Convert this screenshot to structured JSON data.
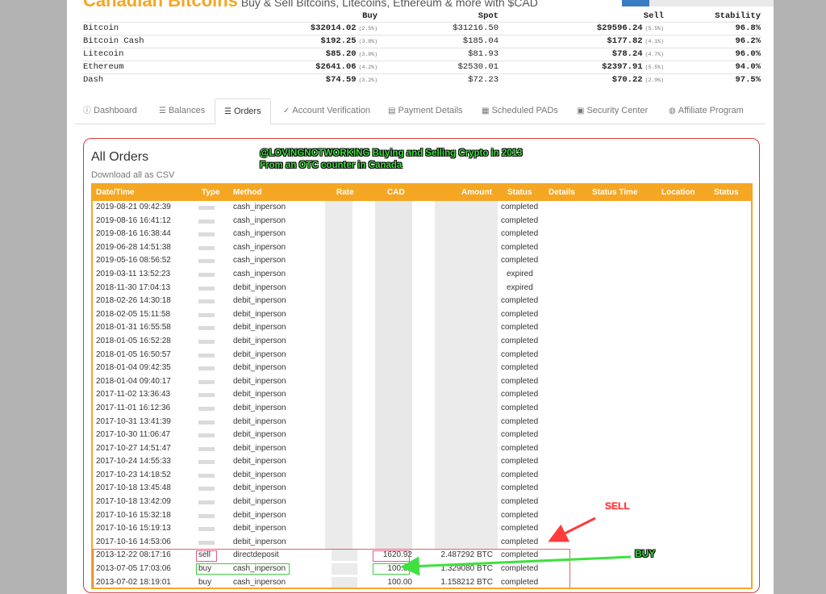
{
  "header": {
    "brand": "Canadian Bitcoins",
    "tagline": "Buy & Sell Bitcoins, Litecoins, Ethereum & more with $CAD"
  },
  "prices": {
    "columns": [
      "Buy",
      "Spot",
      "Sell",
      "Stability"
    ],
    "rows": [
      {
        "name": "Bitcoin",
        "buy": "$32014.02",
        "buy_pct": "(2.5%)",
        "spot": "$31216.50",
        "sell": "$29596.24",
        "sell_pct": "(5.5%)",
        "stability": "96.8%"
      },
      {
        "name": "Bitcoin Cash",
        "buy": "$192.25",
        "buy_pct": "(3.8%)",
        "spot": "$185.04",
        "sell": "$177.82",
        "sell_pct": "(4.1%)",
        "stability": "96.2%"
      },
      {
        "name": "Litecoin",
        "buy": "$85.20",
        "buy_pct": "(3.8%)",
        "spot": "$81.93",
        "sell": "$78.24",
        "sell_pct": "(4.7%)",
        "stability": "96.0%"
      },
      {
        "name": "Ethereum",
        "buy": "$2641.06",
        "buy_pct": "(4.2%)",
        "spot": "$2530.01",
        "sell": "$2397.91",
        "sell_pct": "(5.5%)",
        "stability": "94.0%"
      },
      {
        "name": "Dash",
        "buy": "$74.59",
        "buy_pct": "(3.2%)",
        "spot": "$72.23",
        "sell": "$70.22",
        "sell_pct": "(2.9%)",
        "stability": "97.5%"
      }
    ]
  },
  "tabs": [
    {
      "label": "Dashboard",
      "icon": "info-circle-icon",
      "glyph": "ⓘ"
    },
    {
      "label": "Balances",
      "icon": "list-icon",
      "glyph": "☰"
    },
    {
      "label": "Orders",
      "icon": "list-icon",
      "glyph": "☰",
      "active": true
    },
    {
      "label": "Account Verification",
      "icon": "check-circle-icon",
      "glyph": "✓"
    },
    {
      "label": "Payment Details",
      "icon": "truck-icon",
      "glyph": "▤"
    },
    {
      "label": "Scheduled PADs",
      "icon": "calendar-icon",
      "glyph": "▦"
    },
    {
      "label": "Security Center",
      "icon": "lock-icon",
      "glyph": "▣"
    },
    {
      "label": "Affiliate Program",
      "icon": "globe-icon",
      "glyph": "◍"
    }
  ],
  "orders": {
    "title": "All Orders",
    "csv_link": "Download all as CSV",
    "annotation_line1": "@LOVINGNOTWORKING Buying and Selling Crypto in 2013",
    "annotation_line2": "From an OTC counter in Canada",
    "columns": [
      "Date/Time",
      "Type",
      "Method",
      "Rate",
      "CAD",
      "Amount",
      "Status",
      "Details",
      "Status Time",
      "Location",
      "Status"
    ],
    "rows": [
      {
        "date": "2019-08-21 09:42:39",
        "method": "cash_inperson",
        "status": "completed"
      },
      {
        "date": "2019-08-16 16:41:12",
        "method": "cash_inperson",
        "status": "completed"
      },
      {
        "date": "2019-08-16 16:38:44",
        "method": "cash_inperson",
        "status": "completed"
      },
      {
        "date": "2019-06-28 14:51:38",
        "method": "cash_inperson",
        "status": "completed"
      },
      {
        "date": "2019-05-16 08:56:52",
        "method": "cash_inperson",
        "status": "completed"
      },
      {
        "date": "2019-03-11 13:52:23",
        "method": "cash_inperson",
        "status": "expired"
      },
      {
        "date": "2018-11-30 17:04:13",
        "method": "debit_inperson",
        "status": "expired"
      },
      {
        "date": "2018-02-26 14:30:18",
        "method": "debit_inperson",
        "status": "completed"
      },
      {
        "date": "2018-02-05 15:11:58",
        "method": "debit_inperson",
        "status": "completed"
      },
      {
        "date": "2018-01-31 16:55:58",
        "method": "debit_inperson",
        "status": "completed"
      },
      {
        "date": "2018-01-05 16:52:28",
        "method": "debit_inperson",
        "status": "completed"
      },
      {
        "date": "2018-01-05 16:50:57",
        "method": "debit_inperson",
        "status": "completed"
      },
      {
        "date": "2018-01-04 09:42:35",
        "method": "debit_inperson",
        "status": "completed"
      },
      {
        "date": "2018-01-04 09:40:17",
        "method": "debit_inperson",
        "status": "completed"
      },
      {
        "date": "2017-11-02 13:36:43",
        "method": "debit_inperson",
        "status": "completed"
      },
      {
        "date": "2017-11-01 16:12:36",
        "method": "debit_inperson",
        "status": "completed"
      },
      {
        "date": "2017-10-31 13:41:39",
        "method": "debit_inperson",
        "status": "completed"
      },
      {
        "date": "2017-10-30 11:06:47",
        "method": "debit_inperson",
        "status": "completed"
      },
      {
        "date": "2017-10-27 14:51:47",
        "method": "debit_inperson",
        "status": "completed"
      },
      {
        "date": "2017-10-24 14:55:33",
        "method": "debit_inperson",
        "status": "completed"
      },
      {
        "date": "2017-10-23 14:18:52",
        "method": "debit_inperson",
        "status": "completed"
      },
      {
        "date": "2017-10-18 13:45:48",
        "method": "debit_inperson",
        "status": "completed"
      },
      {
        "date": "2017-10-18 13:42:09",
        "method": "debit_inperson",
        "status": "completed"
      },
      {
        "date": "2017-10-16 15:32:18",
        "method": "debit_inperson",
        "status": "completed"
      },
      {
        "date": "2017-10-16 15:19:13",
        "method": "debit_inperson",
        "status": "completed"
      },
      {
        "date": "2017-10-16 14:53:06",
        "method": "debit_inperson",
        "status": "completed"
      },
      {
        "date": "2013-12-22 08:17:16",
        "type": "sell",
        "method": "directdeposit",
        "cad": "1620.92",
        "amount": "2.487292 BTC",
        "status": "completed"
      },
      {
        "date": "2013-07-05 17:03:06",
        "type": "buy",
        "method": "cash_inperson",
        "cad": "100.00",
        "amount": "1.329080 BTC",
        "status": "completed"
      },
      {
        "date": "2013-07-02 18:19:01",
        "type": "buy",
        "method": "cash_inperson",
        "cad": "100.00",
        "amount": "1.158212 BTC",
        "status": "completed"
      }
    ]
  },
  "annotations": {
    "sell": "SELL",
    "buy": "BUY"
  },
  "colors": {
    "accent_orange": "#f5a623",
    "highlight_red": "#d93a3a",
    "annotation_green": "#3fe03f"
  }
}
